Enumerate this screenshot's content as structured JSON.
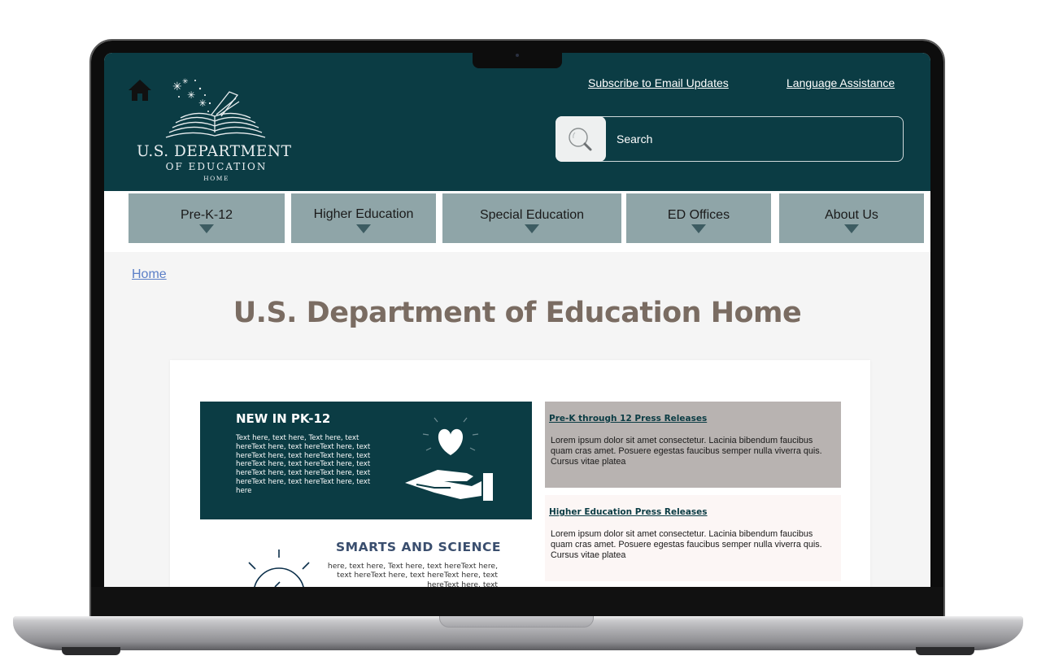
{
  "header": {
    "logo": {
      "line1": "U.S. DEPARTMENT",
      "line2": "OF EDUCATION",
      "line3": "HOME"
    },
    "links": {
      "subscribe": "Subscribe to Email Updates",
      "language": "Language Assistance"
    },
    "search": {
      "placeholder": "Search"
    }
  },
  "nav": {
    "items": [
      {
        "label": "Pre-K-12"
      },
      {
        "label": "Higher Education"
      },
      {
        "label": "Special Education"
      },
      {
        "label": "ED Offices"
      },
      {
        "label": "About Us"
      }
    ]
  },
  "breadcrumb": "Home",
  "page_title": "U.S. Department of Education Home",
  "promo": {
    "title": "NEW IN PK-12",
    "text": "Text here, text here, Text here, text hereText here, text hereText here, text hereText here, text hereText here, text hereText here, text hereText here, text hereText here, text hereText here, text hereText here, text hereText here, text here"
  },
  "smarts": {
    "title": "SMARTS AND SCIENCE",
    "text": "here, text here, Text here, text hereText here, text hereText here, text hereText here, text hereText here, text"
  },
  "press": [
    {
      "title": "Pre-K through 12 Press Releases",
      "body": "Lorem ipsum dolor sit amet consectetur. Lacinia bibendum faucibus quam cras amet. Posuere egestas faucibus semper nulla viverra quis. Cursus vitae platea"
    },
    {
      "title": "Higher Education Press Releases",
      "body": "Lorem ipsum dolor sit amet consectetur. Lacinia bibendum faucibus quam cras amet. Posuere egestas faucibus semper nulla viverra quis. Cursus vitae platea"
    }
  ],
  "colors": {
    "header_bg": "#0b3c44",
    "nav_bg": "#8fa5a8",
    "title": "#7a6c62",
    "link": "#5b7fc7"
  },
  "icons": [
    "home-icon",
    "open-book-logo-icon",
    "search-icon",
    "chevron-down-icon",
    "heart-hand-icon",
    "lightbulb-icon"
  ]
}
